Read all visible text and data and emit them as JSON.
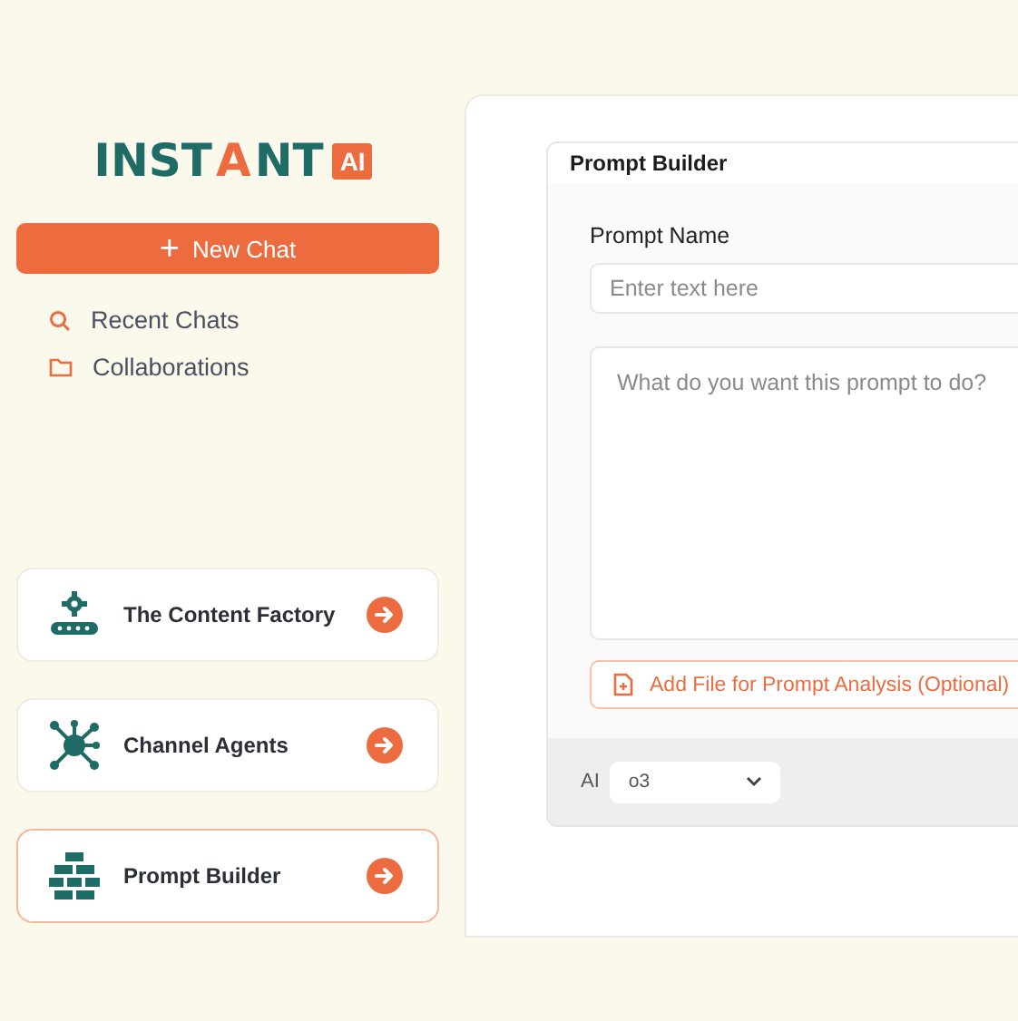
{
  "logo": {
    "parts": [
      {
        "text": "INST",
        "accent": false
      },
      {
        "text": "A",
        "accent": true
      },
      {
        "text": "NT",
        "accent": false
      }
    ],
    "badge": "AI"
  },
  "new_chat": {
    "icon": "+",
    "label": "New Chat"
  },
  "nav": [
    {
      "kind": "search",
      "label": "Recent Chats"
    },
    {
      "kind": "folder",
      "label": "Collaborations"
    }
  ],
  "tools": [
    {
      "kind": "factory",
      "label": "The Content Factory",
      "selected": false
    },
    {
      "kind": "network",
      "label": "Channel Agents",
      "selected": false
    },
    {
      "kind": "bricks",
      "label": "Prompt Builder",
      "selected": true
    }
  ],
  "builder": {
    "title": "Prompt Builder",
    "name_label": "Prompt Name",
    "name_placeholder": "Enter text here",
    "goal_placeholder": "What do you want this prompt to do?",
    "add_file": "Add File for Prompt Analysis (Optional)",
    "model_label": "AI",
    "model": "o3"
  }
}
